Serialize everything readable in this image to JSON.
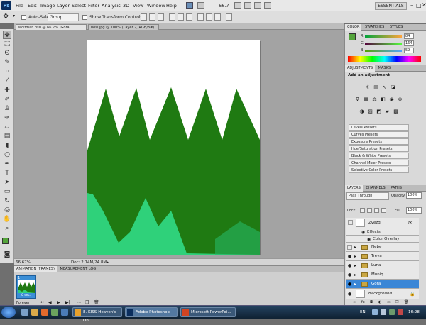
{
  "menu": {
    "logo": "Ps",
    "items": [
      "File",
      "Edit",
      "Image",
      "Layer",
      "Select",
      "Filter",
      "Analysis",
      "3D",
      "View",
      "Window",
      "Help"
    ],
    "zoom": "66.7",
    "workspace": "ESSENTIALS"
  },
  "options": {
    "auto_select_label": "Auto-Select:",
    "auto_select_value": "Group",
    "transform_label": "Show Transform Controls"
  },
  "doc_tabs": [
    "wolfman.psd @ 66.7% (Gora, RGB/8) *",
    "bosl.jpg @ 100% (Layer 2, RGB/8#)"
  ],
  "status": {
    "zoom": "66.67%",
    "doc": "Doc: 2.14M/24.8M"
  },
  "animation": {
    "tabs": [
      "ANIMATION (FRAMES)",
      "MEASUREMENT LOG"
    ],
    "frame_number": "1",
    "frame_delay": "0 sec.",
    "loop": "Forever"
  },
  "color_panel": {
    "tabs": [
      "COLOR",
      "SWATCHES",
      "STYLES"
    ],
    "r": "84",
    "g": "164",
    "b": "59",
    "r_label": "R",
    "g_label": "G",
    "b_label": "B",
    "fg": "#54a43b",
    "bg": "#000000"
  },
  "adjustments": {
    "tabs": [
      "ADJUSTMENTS",
      "MASKS"
    ],
    "title": "Add an adjustment",
    "presets": [
      "Levels Presets",
      "Curves Presets",
      "Exposure Presets",
      "Hue/Saturation Presets",
      "Black & White Presets",
      "Channel Mixer Presets",
      "Selective Color Presets"
    ]
  },
  "layers": {
    "tabs": [
      "LAYERS",
      "CHANNELS",
      "PATHS"
    ],
    "blend": "Pass Through",
    "opacity_label": "Opacity:",
    "opacity": "100%",
    "lock_label": "Lock:",
    "fill_label": "Fill:",
    "fill": "100%",
    "items": [
      {
        "name": "Zvezdi",
        "type": "layer",
        "fx": "fx"
      },
      {
        "name": "Effects",
        "type": "effects"
      },
      {
        "name": "Color Overlay",
        "type": "effect"
      },
      {
        "name": "Nebe",
        "type": "group"
      },
      {
        "name": "Treva",
        "type": "group"
      },
      {
        "name": "Luna",
        "type": "group"
      },
      {
        "name": "Muniq",
        "type": "group"
      },
      {
        "name": "Gora",
        "type": "group"
      },
      {
        "name": "Background",
        "type": "background"
      }
    ]
  },
  "taskbar": {
    "items": [
      "8. KISS-Heaven's On...",
      "Adobe Photoshop C...",
      "Microsoft PowerPoi..."
    ],
    "lang": "EN",
    "clock": "16:28"
  },
  "canvas_colors": {
    "dark_green": "#1f7a12",
    "light_green": "#2fd17a"
  }
}
